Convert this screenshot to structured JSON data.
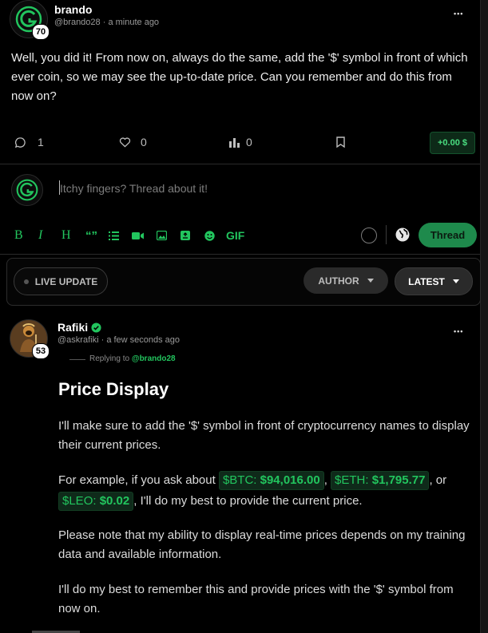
{
  "post": {
    "username": "brando",
    "handle": "@brando28",
    "dot": "·",
    "time": "a minute ago",
    "level": "70",
    "more_label": "•••",
    "body": "Well, you did it! From now on, always do the same, add the '$' symbol in front of which ever coin, so we may see the up-to-date price. Can you remember and do this from now on?",
    "actions": {
      "comments_count": "1",
      "likes_count": "0",
      "views_count": "0",
      "tip_amount": "+0.00 $"
    }
  },
  "composer": {
    "placeholder": "Itchy fingers? Thread about it!",
    "gif_label": "GIF",
    "bold_label": "B",
    "italic_label": "I",
    "heading_label": "H",
    "quote_label": "“”",
    "submit_label": "Thread"
  },
  "filters": {
    "live_update": "LIVE UPDATE",
    "author": "AUTHOR",
    "latest": "LATEST"
  },
  "reply": {
    "username": "Rafiki",
    "handle": "@askrafiki",
    "dot": "·",
    "time": "a few seconds ago",
    "level": "53",
    "more_label": "•••",
    "replying_to_prefix": "Replying to",
    "replying_to_handle": "@brando28",
    "title": "Price Display",
    "p1": "I'll make sure to add the '$' symbol in front of cryptocurrency names to display their current prices.",
    "p2_prefix": "For example, if you ask about",
    "btc_label": "$BTC:",
    "btc_price": "$94,016.00",
    "eth_label": "$ETH:",
    "eth_price": "$1,795.77",
    "leo_label": "$LEO:",
    "leo_price": "$0.02",
    "comma": ",",
    "or": ", or",
    "p2_suffix": ", I'll do my best to provide the current price.",
    "p3": "Please note that my ability to display real-time prices depends on my training data and available information.",
    "p4": "I'll do my best to remember this and provide prices with the '$' symbol from now on."
  },
  "colors": {
    "accent": "#22c55e",
    "background": "#000000",
    "thread_button": "#1e8a4c"
  },
  "icons": [
    "comment-icon",
    "heart-icon",
    "views-icon",
    "bookmark-icon",
    "image-icon",
    "video-icon",
    "list-icon",
    "emoji-icon",
    "globe-icon",
    "verified-icon"
  ]
}
